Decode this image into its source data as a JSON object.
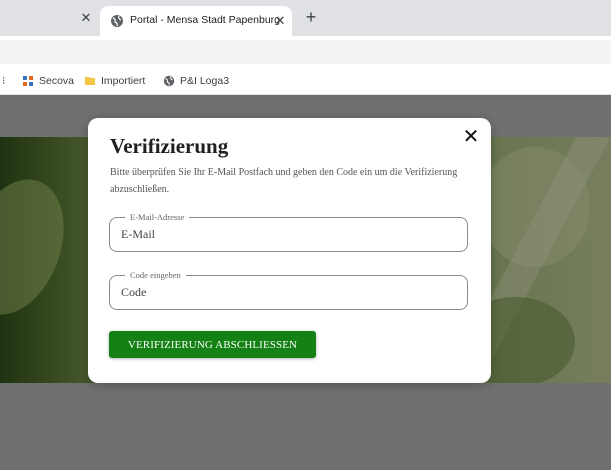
{
  "browser": {
    "tabs": [
      {
        "label": "Portal - Mensa Stadt Papenburg",
        "active": true
      }
    ],
    "bookmarks": [
      {
        "label": "Secova",
        "icon": "secova-icon"
      },
      {
        "label": "Importiert",
        "icon": "folder-icon"
      },
      {
        "label": "P&I Loga3",
        "icon": "globe-icon"
      }
    ]
  },
  "modal": {
    "title": "Verifizierung",
    "description": "Bitte überprüfen Sie Ihr E-Mail Postfach und geben den Code ein um die Verifizierung abzuschließen.",
    "close_icon": "close-icon",
    "fields": {
      "email": {
        "legend": "E-Mail-Adresse",
        "placeholder": "E-Mail",
        "value": ""
      },
      "code": {
        "legend": "Code eingeben",
        "placeholder": "Code",
        "value": ""
      }
    },
    "button_label": "VERIFIZIERUNG ABSCHLIESSEN"
  },
  "colors": {
    "button": "#138113",
    "overlay": "#707070",
    "tabstrip": "#dfe1e5",
    "folder": "#f4c542"
  }
}
